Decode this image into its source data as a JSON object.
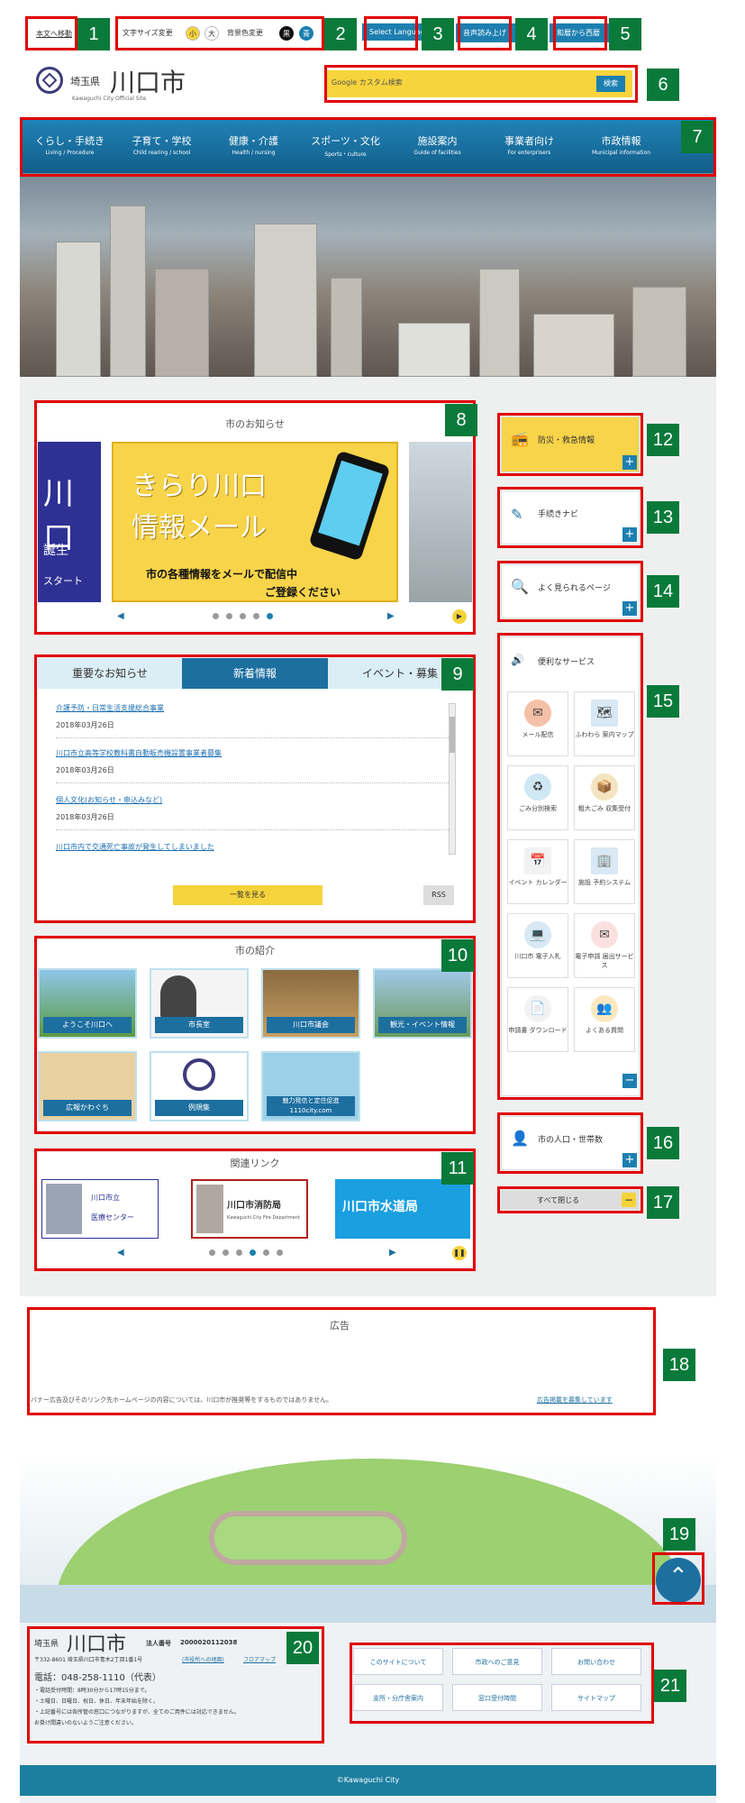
{
  "topbar": {
    "skip": "本文へ移動",
    "fontsize_label": "文字サイズ変更",
    "font_small": "小",
    "font_large": "大",
    "bg_label": "背景色変更",
    "bg_black": "黒",
    "bg_blue": "青",
    "lang": "Select Language",
    "voice": "音声読み上げ",
    "furigana": "和暦から西暦"
  },
  "header": {
    "pref": "埼玉県",
    "city": "川口市",
    "sub": "Kawaguchi City Official Site",
    "search_placeholder": "Google カスタム検索",
    "search_btn": "検索"
  },
  "nav": [
    {
      "jp": "くらし・手続き",
      "en": "Living / Procedure"
    },
    {
      "jp": "子育て・学校",
      "en": "Child rearing / school"
    },
    {
      "jp": "健康・介護",
      "en": "Health / nursing"
    },
    {
      "jp": "スポーツ・文化",
      "en": "Sports・culture"
    },
    {
      "jp": "施設案内",
      "en": "Guide of facilities"
    },
    {
      "jp": "事業者向け",
      "en": "For enterprisers"
    },
    {
      "jp": "市政情報",
      "en": "Municipal information"
    }
  ],
  "notice": {
    "title": "市のお知らせ",
    "slide_title_1": "きらり川口",
    "slide_title_2": "情報メール",
    "slide_sub_1": "市の各種情報をメールで配信中",
    "slide_sub_2": "ご登録ください",
    "left_slide_1": "川口",
    "left_slide_2": "誕生",
    "left_slide_3": "スタート"
  },
  "news": {
    "tabs": [
      "重要なお知らせ",
      "新着情報",
      "イベント・募集"
    ],
    "items": [
      {
        "title": "介護予防・日常生活支援総合事業",
        "date": "2018年03月26日"
      },
      {
        "title": "川口市立高等学校教科書自動販売機設置事業者募集",
        "date": "2018年03月26日"
      },
      {
        "title": "個人文化(お知らせ・申込みなど)",
        "date": "2018年03月26日"
      },
      {
        "title": "川口市内で交通死亡事故が発生してしまいました",
        "date": ""
      }
    ],
    "more": "一覧を見る",
    "rss": "RSS"
  },
  "intro": {
    "title": "市の紹介",
    "items": [
      "ようこそ川口へ",
      "市長室",
      "川口市議会",
      "観光・イベント情報",
      "広報かわぐち",
      "例規集",
      "魅力発信と定住促進 1110city.com"
    ]
  },
  "links": {
    "title": "関連リンク",
    "items": [
      {
        "line1": "川口市立",
        "line2": "医療センター"
      },
      {
        "line1": "川口市消防局",
        "line2": "Kawaguchi City Fire Department"
      },
      {
        "line1": "川口市水道局",
        "line2": ""
      }
    ]
  },
  "side": {
    "disaster": "防災・救急情報",
    "procedure": "手続きナビ",
    "popular": "よく見られるページ",
    "services_title": "便利なサービス",
    "services": [
      "メール配信",
      "ふわわら 案内マップ",
      "ごみ分別検索",
      "粗大ごみ 収集受付",
      "イベント カレンダー",
      "施設 予約システム",
      "川口市 電子入札",
      "電子申請 届出サービス",
      "申請書 ダウンロード",
      "よくある質問"
    ],
    "population": "市の人口・世帯数",
    "close_all": "すべて閉じる"
  },
  "ad": {
    "title": "広告",
    "disclaimer": "バナー広告及びそのリンク先ホームページの内容については、川口市が推奨等をするものではありません。",
    "recruit": "広告掲載を募集しています"
  },
  "footer": {
    "pref": "埼玉県",
    "city": "川口市",
    "corp_label": "法人番号",
    "corp_no": "2000020112038",
    "address": "〒332-8601  埼玉県川口市青木2丁目1番1号",
    "map_link": "(市役所への地図)",
    "floor_link": "フロアマップ",
    "phone": "電話：048-258-1110（代表）",
    "note1": "・電話受付時間：8時30分から17時15分まで。",
    "note2": "・土曜日、日曜日、祝日、休日、年末年始を除く。",
    "note3": "・上記番号には各所管の窓口につながりますが、全てのご用件には対応できません。",
    "note4": "  お掛け間違いのないようご注意ください。",
    "links": [
      "このサイトについて",
      "市政へのご意見",
      "お問い合わせ",
      "支所・分庁舎案内",
      "窓口受付時間",
      "サイトマップ"
    ],
    "copyright": "©Kawaguchi City"
  },
  "labels": [
    "1",
    "2",
    "3",
    "4",
    "5",
    "6",
    "7",
    "8",
    "9",
    "10",
    "11",
    "12",
    "13",
    "14",
    "15",
    "16",
    "17",
    "18",
    "19",
    "20",
    "21"
  ]
}
